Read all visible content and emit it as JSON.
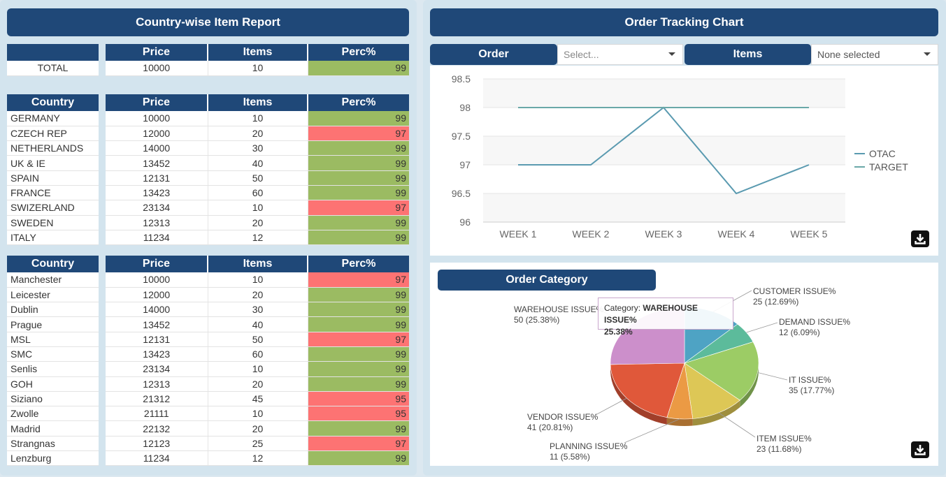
{
  "left": {
    "title": "Country-wise Item Report",
    "headers": {
      "price": "Price",
      "items": "Items",
      "perc": "Perc%",
      "country": "Country"
    },
    "total": {
      "label": "TOTAL",
      "price": "10000",
      "items": "10",
      "perc": "99",
      "status": "good"
    },
    "countries": [
      {
        "name": "GERMANY",
        "price": "10000",
        "items": "10",
        "perc": "99",
        "status": "good"
      },
      {
        "name": "CZECH REP",
        "price": "12000",
        "items": "20",
        "perc": "97",
        "status": "bad"
      },
      {
        "name": "NETHERLANDS",
        "price": "14000",
        "items": "30",
        "perc": "99",
        "status": "good"
      },
      {
        "name": "UK & IE",
        "price": "13452",
        "items": "40",
        "perc": "99",
        "status": "good"
      },
      {
        "name": "SPAIN",
        "price": "12131",
        "items": "50",
        "perc": "99",
        "status": "good"
      },
      {
        "name": "FRANCE",
        "price": "13423",
        "items": "60",
        "perc": "99",
        "status": "good"
      },
      {
        "name": "SWIZERLAND",
        "price": "23134",
        "items": "10",
        "perc": "97",
        "status": "bad"
      },
      {
        "name": "SWEDEN",
        "price": "12313",
        "items": "20",
        "perc": "99",
        "status": "good"
      },
      {
        "name": "ITALY",
        "price": "11234",
        "items": "12",
        "perc": "99",
        "status": "good"
      }
    ],
    "cities": [
      {
        "name": "Manchester",
        "price": "10000",
        "items": "10",
        "perc": "97",
        "status": "bad"
      },
      {
        "name": "Leicester",
        "price": "12000",
        "items": "20",
        "perc": "99",
        "status": "good"
      },
      {
        "name": "Dublin",
        "price": "14000",
        "items": "30",
        "perc": "99",
        "status": "good"
      },
      {
        "name": "Prague",
        "price": "13452",
        "items": "40",
        "perc": "99",
        "status": "good"
      },
      {
        "name": "MSL",
        "price": "12131",
        "items": "50",
        "perc": "97",
        "status": "bad"
      },
      {
        "name": "SMC",
        "price": "13423",
        "items": "60",
        "perc": "99",
        "status": "good"
      },
      {
        "name": "Senlis",
        "price": "23134",
        "items": "10",
        "perc": "99",
        "status": "good"
      },
      {
        "name": "GOH",
        "price": "12313",
        "items": "20",
        "perc": "99",
        "status": "good"
      },
      {
        "name": "Siziano",
        "price": "21312",
        "items": "45",
        "perc": "95",
        "status": "bad"
      },
      {
        "name": "Zwolle",
        "price": "21111",
        "items": "10",
        "perc": "95",
        "status": "bad"
      },
      {
        "name": "Madrid",
        "price": "22132",
        "items": "20",
        "perc": "99",
        "status": "good"
      },
      {
        "name": "Strangnas",
        "price": "12123",
        "items": "25",
        "perc": "97",
        "status": "bad"
      },
      {
        "name": "Lenzburg",
        "price": "11234",
        "items": "12",
        "perc": "99",
        "status": "good"
      }
    ]
  },
  "right": {
    "title": "Order Tracking Chart",
    "filters": {
      "order_label": "Order",
      "order_placeholder": "Select...",
      "items_label": "Items",
      "items_value": "None selected"
    },
    "category_title": "Order Category",
    "tooltip": {
      "prefix": "Category: ",
      "category": "WAREHOUSE ISSUE%",
      "value": "25.38%"
    },
    "download_icon": "download-icon"
  },
  "colors": {
    "header": "#1f4878",
    "good": "#9bbb62",
    "bad": "#fd7373",
    "line": "#5a9ab0"
  },
  "chart_data": [
    {
      "type": "line",
      "categories": [
        "WEEK 1",
        "WEEK 2",
        "WEEK 3",
        "WEEK 4",
        "WEEK 5"
      ],
      "series": [
        {
          "name": "OTAC",
          "values": [
            97,
            97,
            98,
            96.5,
            97
          ]
        },
        {
          "name": "TARGET",
          "values": [
            98,
            98,
            98,
            98,
            98
          ]
        }
      ],
      "yticks": [
        "98.5",
        "98",
        "97.5",
        "97",
        "96.5",
        "96"
      ],
      "ylim": [
        96,
        98.5
      ],
      "legend": "right"
    },
    {
      "type": "pie",
      "slices": [
        {
          "label": "CUSTOMER ISSUE%",
          "value": 25,
          "text": "25 (12.69%)",
          "color": "#4ea3c4"
        },
        {
          "label": "DEMAND ISSUE%",
          "value": 12,
          "text": "12 (6.09%)",
          "color": "#5cbb9b"
        },
        {
          "label": "IT ISSUE%",
          "value": 35,
          "text": "35 (17.77%)",
          "color": "#9ccc65"
        },
        {
          "label": "ITEM ISSUE%",
          "value": 23,
          "text": "23 (11.68%)",
          "color": "#ddc756"
        },
        {
          "label": "PLANNING ISSUE%",
          "value": 11,
          "text": "11 (5.58%)",
          "color": "#eb9a44"
        },
        {
          "label": "VENDOR ISSUE%",
          "value": 41,
          "text": "41 (20.81%)",
          "color": "#e0583a"
        },
        {
          "label": "WAREHOUSE ISSUE%",
          "value": 50,
          "text": "50 (25.38%)",
          "color": "#cc8fcb"
        }
      ]
    }
  ]
}
